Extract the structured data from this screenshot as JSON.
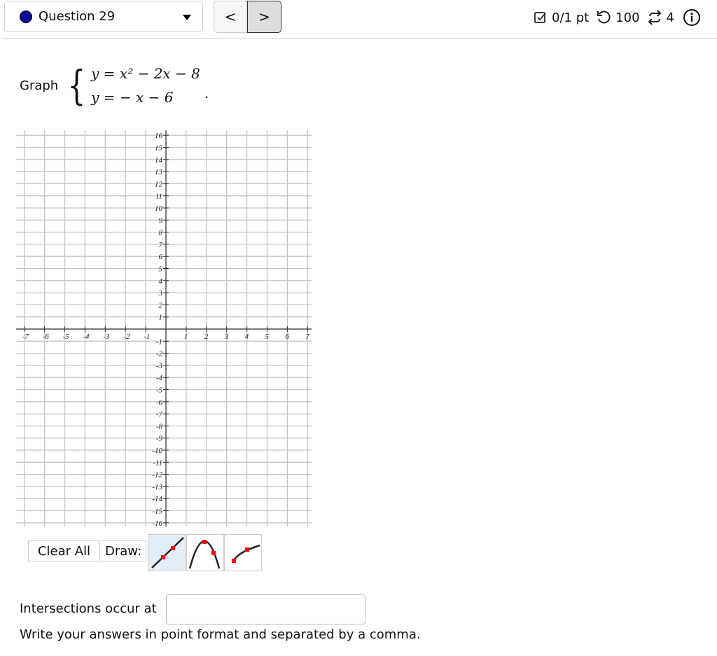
{
  "header": {
    "question_label": "Question 29",
    "prev_icon": "chevron-left",
    "next_icon": "chevron-right",
    "prev_glyph": "<",
    "next_glyph": ">",
    "score": "0/1 pt",
    "retries": "100",
    "attempts": "4",
    "status_color": "#0a0a9a"
  },
  "prompt": {
    "lead": "Graph",
    "eq1": {
      "lhs": "y",
      "rhs": "x² − 2x − 8"
    },
    "eq2": {
      "lhs": "y",
      "rhs": "− x − 6"
    },
    "period": "."
  },
  "graph": {
    "x_range": [
      -7,
      7
    ],
    "y_range": [
      -16,
      16
    ],
    "grid": true
  },
  "tools": {
    "clear_label": "Clear All",
    "draw_label": "Draw:",
    "items": [
      "line-tool",
      "parabola-tool",
      "sqrt-curve-tool"
    ],
    "selected": "line-tool"
  },
  "answer": {
    "label": "Intersections occur at",
    "value": "",
    "note": "Write your answers in point format and separated by a comma."
  }
}
